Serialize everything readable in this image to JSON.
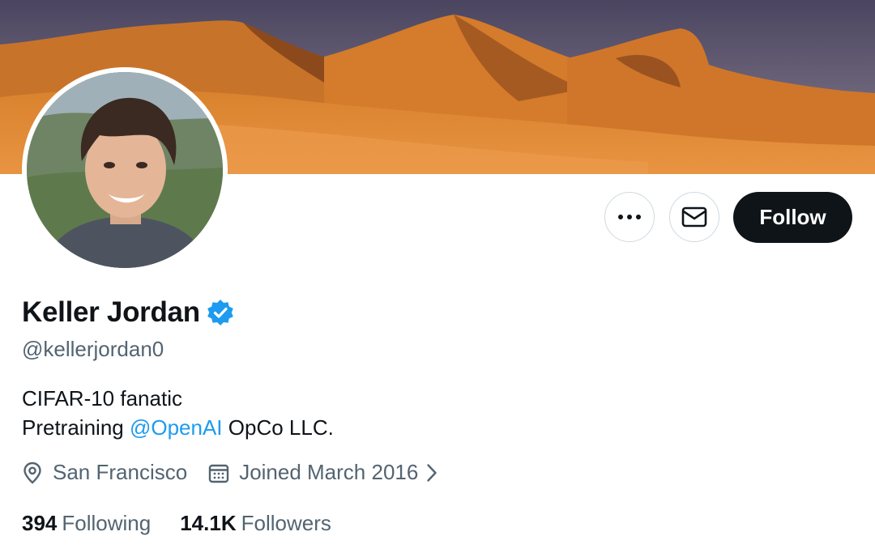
{
  "profile": {
    "display_name": "Keller Jordan",
    "handle": "@kellerjordan0",
    "bio_line1": "CIFAR-10 fanatic",
    "bio_line2_prefix": "Pretraining ",
    "bio_line2_mention": "@OpenAI",
    "bio_line2_suffix": " OpCo LLC.",
    "location": "San Francisco",
    "joined": "Joined March 2016"
  },
  "stats": {
    "following_count": "394",
    "following_label": "Following",
    "followers_count": "14.1K",
    "followers_label": "Followers"
  },
  "actions": {
    "follow_label": "Follow"
  },
  "icons": {
    "more": "more-icon",
    "message": "envelope-icon",
    "verified": "verified-badge-icon",
    "location": "location-pin-icon",
    "calendar": "calendar-icon",
    "chevron": "chevron-right-icon"
  },
  "colors": {
    "accent": "#1d9bf0",
    "text": "#0f1419",
    "secondary_text": "#536471",
    "follow_button": "#0f1419",
    "border": "#cfd9de"
  }
}
